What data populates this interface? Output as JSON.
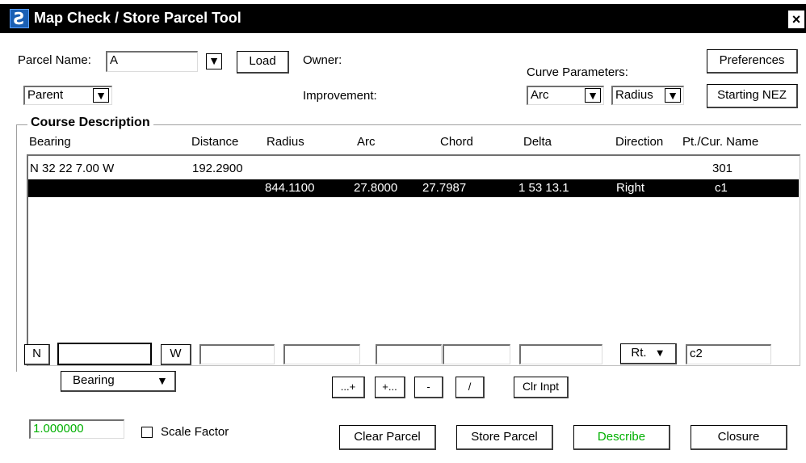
{
  "window": {
    "title": "Map Check / Store Parcel Tool",
    "close_glyph": "×",
    "app_icon_glyph": "Ƨ"
  },
  "top": {
    "parcel_name_label": "Parcel Name:",
    "parcel_name_value": "A",
    "load_label": "Load",
    "owner_label": "Owner:",
    "improvement_label": "Improvement:",
    "curve_parameters_label": "Curve Parameters:",
    "preferences_label": "Preferences",
    "starting_nez_label": "Starting NEZ",
    "parent_select": "Parent",
    "curve_type_select": "Arc",
    "curve_param_select": "Radius"
  },
  "course": {
    "group_label": "Course Description",
    "columns": [
      "Bearing",
      "Distance",
      "Radius",
      "Arc",
      "Chord",
      "Delta",
      "Direction",
      "Pt./Cur. Name"
    ],
    "rows": [
      {
        "bearing": "N 32 22 7.00 W",
        "distance": "192.2900",
        "radius": "",
        "arc": "",
        "chord": "",
        "delta": "",
        "direction": "",
        "name": "301",
        "selected": false
      },
      {
        "bearing": "",
        "distance": "",
        "radius": "844.1100",
        "arc": "27.8000",
        "chord": "27.7987",
        "delta": "1 53 13.1",
        "direction": "Right",
        "name": "c1",
        "selected": true
      }
    ]
  },
  "input": {
    "n_label": "N",
    "w_label": "W",
    "direction_select": "Rt.",
    "name_value": "c2",
    "bearing_select": "Bearing",
    "op_buttons": [
      "...+",
      "+...",
      "-",
      "/"
    ],
    "clr_inpt_label": "Clr Inpt"
  },
  "bottom": {
    "scale_value": "1.000000",
    "scale_factor_label": "Scale Factor",
    "clear_parcel_label": "Clear Parcel",
    "store_parcel_label": "Store Parcel",
    "describe_label": "Describe",
    "closure_label": "Closure",
    "accent_green": "#00b000"
  },
  "icons": {
    "dropdown": "▼"
  }
}
